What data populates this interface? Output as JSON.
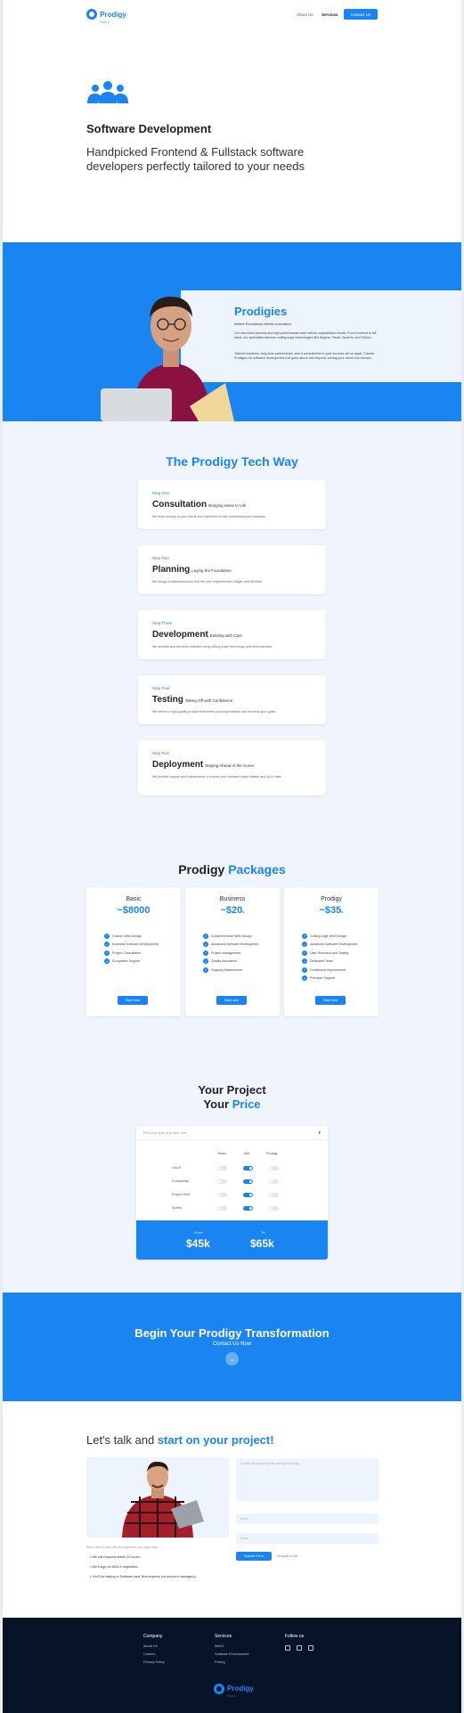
{
  "nav": {
    "brand": "Prodigy",
    "brand_sub": "TECH",
    "links": [
      "About Us",
      "Services"
    ],
    "cta": "Contact Us"
  },
  "hero": {
    "title": "Software Development",
    "subtitle": "Handpicked Frontend & Fullstack software developers perfectly tailored to your needs"
  },
  "prodigies": {
    "title": "Prodigies",
    "tagline": "Where Excellence Meets Innovation",
    "p1": "Our structured process and high performance team deliver unparalleled results. From frontend to full stack, our specialists harness cutting edge technologies like Angular, React, NodeJs, and Python.",
    "p2": "Tailored solutions, long-term partnerships, and a commitment to your success set us apart. Choose Prodigies for software development that goes above and beyond, turning your vision into triumph."
  },
  "tech_way": {
    "title": "The Prodigy Tech Way",
    "steps": [
      {
        "num": "Step One",
        "name": "Consultation",
        "tag": "Bringing Ideas to Life",
        "desc": "We listen closely to your needs and objectives to fully understand your business."
      },
      {
        "num": "Step Two",
        "name": "Planning",
        "tag": "Laying the Foundation",
        "desc": "We design a tailored solution that fits your requirements, budget, and timeline."
      },
      {
        "num": "Step Three",
        "name": "Development",
        "tag": "Building with Care",
        "desc": "We develop and test your software using cutting-edge technology and best practices."
      },
      {
        "num": "Step Four",
        "name": "Testing",
        "tag": "Taking Off with Confidence",
        "desc": "We deliver a high-quality product that meets your expectations and exceeds your goals."
      },
      {
        "num": "Step Five",
        "name": "Deployment",
        "tag": "Staying Ahead of the Curve",
        "desc": "We provide support and maintenance to ensure your software stays reliable and up-to-date."
      }
    ]
  },
  "packages": {
    "title_a": "Prodigy",
    "title_b": "Packages",
    "items": [
      {
        "name": "Basic",
        "price": "~$8000",
        "unit": "",
        "cta": "Start now",
        "features": [
          "Custom Web Design",
          "Essential Software Development",
          "Project Consultation",
          "Ecosystem Support"
        ]
      },
      {
        "name": "Business",
        "price": "~$20",
        "unit": "k",
        "cta": "Start now",
        "features": [
          "Comprehensive Web Design",
          "Advanced Software Development",
          "Project management",
          "Quality Assurance",
          "Ongoing Maintenance"
        ]
      },
      {
        "name": "Prodigy",
        "price": "~$35",
        "unit": "k",
        "cta": "Start now",
        "features": [
          "Cutting-edge Web Design",
          "Advanced Software Development",
          "User Research and Testing",
          "Dedicated Team",
          "Continuous Improvement",
          "Premium Support"
        ]
      }
    ]
  },
  "calculator": {
    "title_a": "Your Project",
    "title_b1": "Your",
    "title_b2": "Price",
    "select_placeholder": "Pick your type of project now",
    "columns": [
      "Basic",
      "Mid",
      "Prodigy"
    ],
    "rows": [
      "UI/UX",
      "Complexity",
      "Project Size",
      "Speed"
    ],
    "selected_level": [
      "Mid",
      "Mid",
      "Mid",
      "Mid"
    ],
    "from_label": "From:",
    "from_value": "$45k",
    "to_label": "To:",
    "to_value": "$65k"
  },
  "cta": {
    "title": "Begin Your Prodigy Transformation",
    "sub": "Contact Us Now"
  },
  "contact": {
    "title_a": "Let's talk and",
    "title_b": "start on your project!",
    "note": "We're here to help with any questions you might have",
    "bullets": [
      "We will respond within 24 hours.",
      "We'll sign an NDA if requested.",
      "You'll be talking to Software and Tech experts (no account managers)."
    ],
    "message_placeholder": "Explain the project you're looking to develop",
    "name_placeholder": "Name",
    "email_placeholder": "Email",
    "submit": "Submit Form",
    "or_text": "Or book a Call"
  },
  "footer": {
    "company_head": "Company",
    "company_links": [
      "About Us",
      "Careers",
      "Privacy Policy"
    ],
    "services_head": "Services",
    "services_links": [
      "Web3",
      "Software Development",
      "Pricing"
    ],
    "follow_head": "Follow us",
    "brand": "Prodigy",
    "brand_sub": "TECH"
  },
  "colors": {
    "accent": "#1a84f0",
    "footer_bg": "#071428",
    "section_bg": "#eff4fd"
  }
}
